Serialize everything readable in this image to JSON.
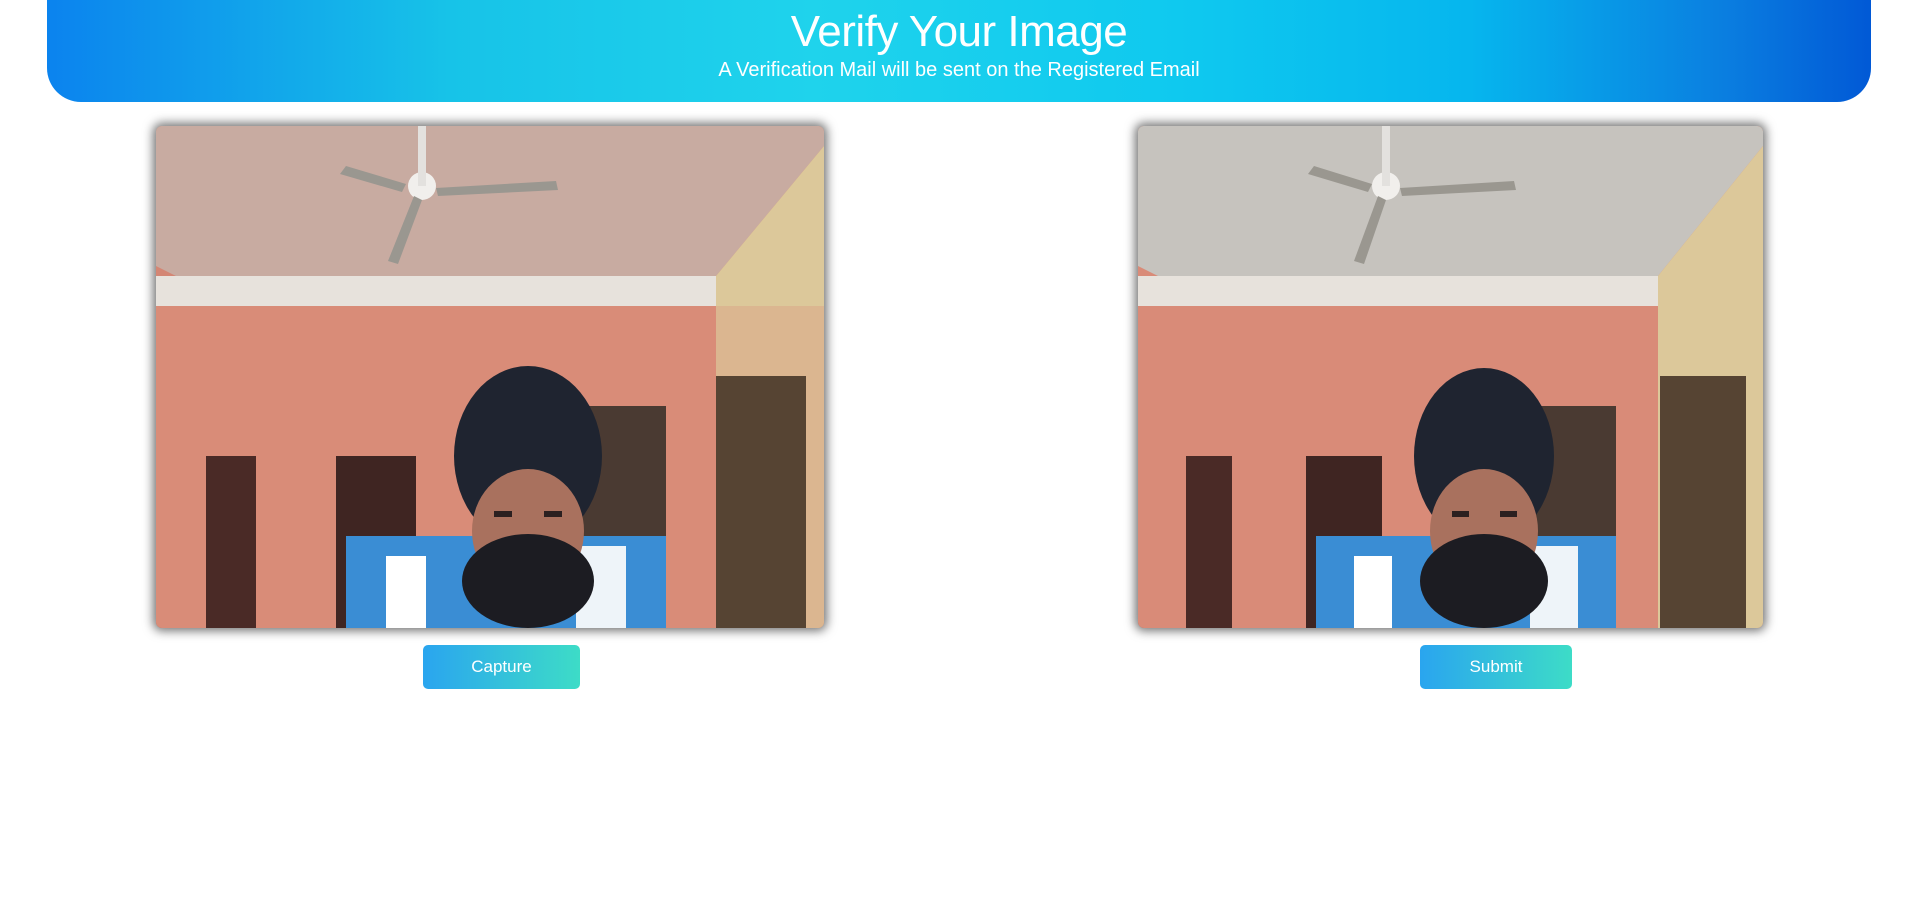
{
  "header": {
    "title": "Verify Your Image",
    "subtitle": "A Verification Mail will be sent on the Registered Email"
  },
  "webcam": {
    "image_description": "live webcam feed"
  },
  "captured": {
    "image_description": "captured photo"
  },
  "buttons": {
    "capture_label": "Capture",
    "submit_label": "Submit"
  },
  "colors": {
    "header_gradient_start": "#0b83ee",
    "header_gradient_mid": "#1fd3ec",
    "header_gradient_end": "#0159d6",
    "button_gradient_start": "#2aa5ef",
    "button_gradient_end": "#3ddcc7"
  }
}
